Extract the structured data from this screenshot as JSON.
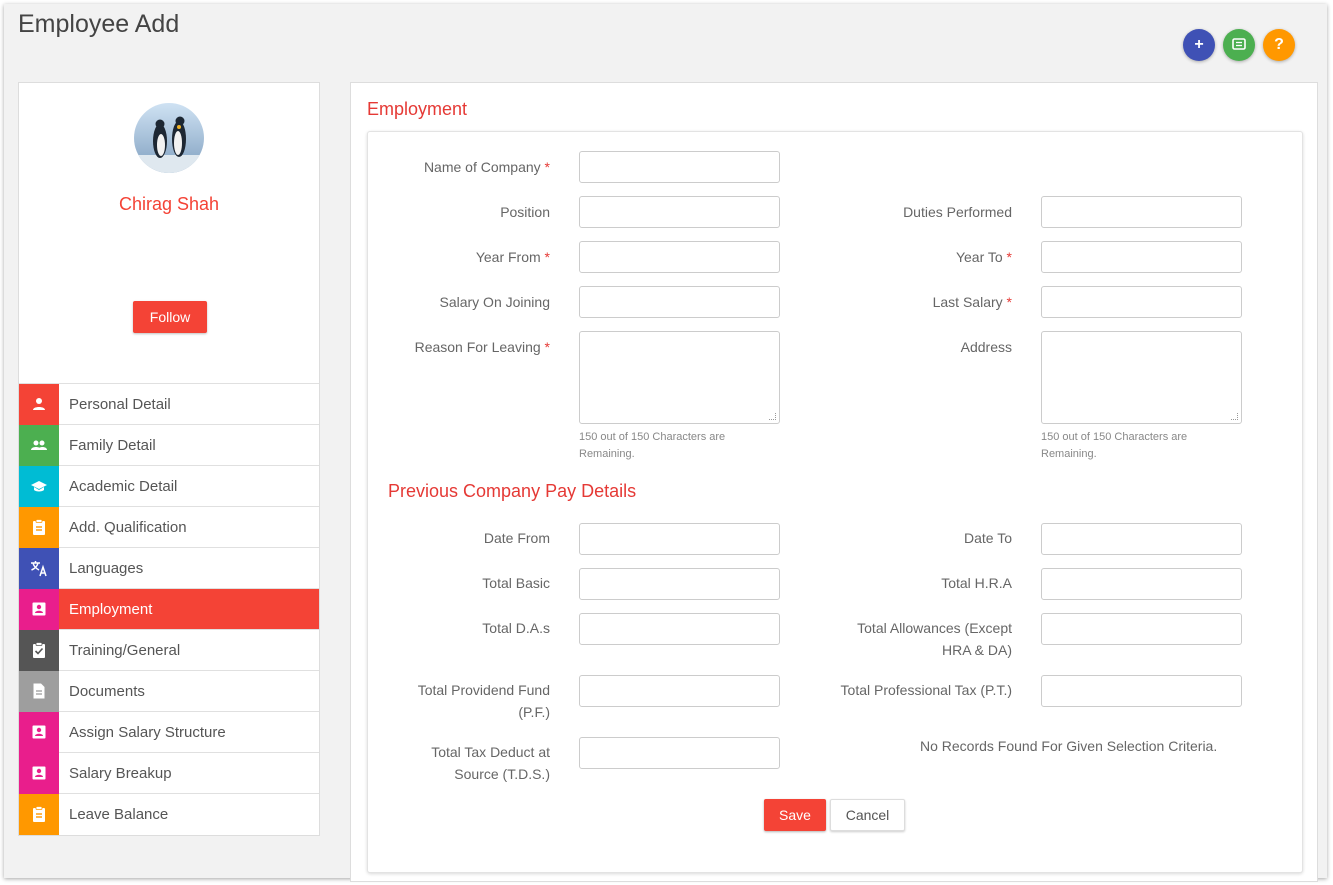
{
  "page": {
    "title": "Employee Add"
  },
  "top_actions": {
    "add_label": "+",
    "help_label": "?"
  },
  "profile": {
    "name": "Chirag Shah",
    "follow_label": "Follow"
  },
  "sidebar": {
    "items": [
      {
        "label": "Personal Detail",
        "icon": "person-icon",
        "color": "#f44336"
      },
      {
        "label": "Family Detail",
        "icon": "people-icon",
        "color": "#4caf50"
      },
      {
        "label": "Academic Detail",
        "icon": "graduation-cap-icon",
        "color": "#00bcd4"
      },
      {
        "label": "Add. Qualification",
        "icon": "clipboard-icon",
        "color": "#ff9800"
      },
      {
        "label": "Languages",
        "icon": "translate-icon",
        "color": "#3f51b5"
      },
      {
        "label": "Employment",
        "icon": "contact-card-icon",
        "color": "#e91e8c",
        "active": true
      },
      {
        "label": "Training/General",
        "icon": "clipboard-check-icon",
        "color": "#555555"
      },
      {
        "label": "Documents",
        "icon": "document-icon",
        "color": "#9e9e9e"
      },
      {
        "label": "Assign Salary Structure",
        "icon": "contact-card-icon",
        "color": "#e91e8c"
      },
      {
        "label": "Salary Breakup",
        "icon": "contact-card-icon",
        "color": "#e91e8c"
      },
      {
        "label": "Leave Balance",
        "icon": "clipboard-icon",
        "color": "#ff9800"
      }
    ]
  },
  "employment": {
    "section_title": "Employment",
    "name_of_company": "Name of Company",
    "position": "Position",
    "duties_performed": "Duties Performed",
    "year_from": "Year From",
    "year_to": "Year To",
    "salary_on_joining": "Salary On Joining",
    "last_salary": "Last Salary",
    "reason_for_leaving": "Reason For Leaving",
    "address": "Address",
    "required_marker": "*",
    "char_hint": "150 out of 150 Characters are Remaining."
  },
  "pay_details": {
    "section_title": "Previous Company Pay Details",
    "date_from": "Date From",
    "date_to": "Date To",
    "total_basic": "Total Basic",
    "total_hra": "Total H.R.A",
    "total_das": "Total D.A.s",
    "total_allowances": "Total Allowances (Except HRA & DA)",
    "total_pf": "Total Providend Fund (P.F.)",
    "total_pt": "Total Professional Tax (P.T.)",
    "total_tds": "Total Tax Deduct at Source (T.D.S.)",
    "no_records": "No Records Found For Given Selection Criteria."
  },
  "actions": {
    "save_label": "Save",
    "cancel_label": "Cancel"
  },
  "colors": {
    "accent": "#f44336",
    "title_red": "#e53935"
  }
}
